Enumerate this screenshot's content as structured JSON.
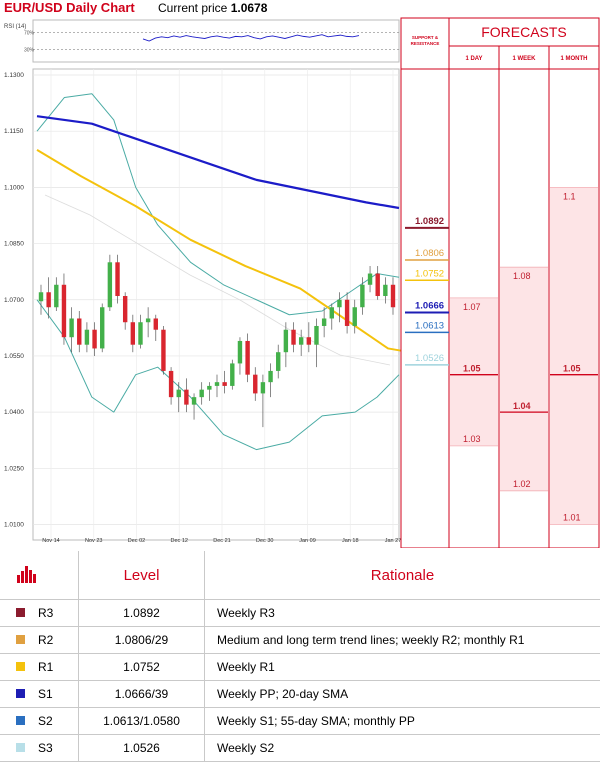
{
  "header": {
    "title": "EUR/USD Daily Chart",
    "price_label": "Current price",
    "price_value": "1.0678"
  },
  "rsi_label": "RSI (14)",
  "rsi_ticks": [
    "70%",
    "30%"
  ],
  "support_resistance_label": [
    "SUPPORT &",
    "RESISTANCE"
  ],
  "forecasts": {
    "title": "FORECASTS",
    "columns": [
      "1 DAY",
      "1 WEEK",
      "1 MONTH"
    ]
  },
  "colors": {
    "red": "#d0021b",
    "sma_long": "#1c1cc8",
    "sma_short": "#f4c20d",
    "bollinger": "#4aaba4",
    "up_candle": "#43b04a",
    "down_candle": "#d9262f",
    "pink_fill": "#fde4e6"
  },
  "chart_data": {
    "type": "candlestick",
    "title": "EUR/USD Daily Chart",
    "y_ticks": [
      "1.1300",
      "1.1150",
      "1.1000",
      "1.0850",
      "1.0700",
      "1.0550",
      "1.0400",
      "1.0250",
      "1.0100"
    ],
    "ylim": [
      1.008,
      1.13
    ],
    "x_ticks": [
      "Nov 14",
      "Nov 23",
      "Dec 02",
      "Dec 12",
      "Dec 21",
      "Dec 30",
      "Jan 09",
      "Jan 18",
      "Jan 27"
    ],
    "grid": true,
    "candles": [
      [
        1.0696,
        1.074,
        1.066,
        1.072
      ],
      [
        1.072,
        1.076,
        1.065,
        1.068
      ],
      [
        1.068,
        1.076,
        1.067,
        1.074
      ],
      [
        1.074,
        1.077,
        1.058,
        1.06
      ],
      [
        1.06,
        1.068,
        1.056,
        1.065
      ],
      [
        1.065,
        1.067,
        1.056,
        1.058
      ],
      [
        1.058,
        1.064,
        1.056,
        1.062
      ],
      [
        1.062,
        1.064,
        1.055,
        1.057
      ],
      [
        1.057,
        1.069,
        1.056,
        1.068
      ],
      [
        1.068,
        1.082,
        1.067,
        1.08
      ],
      [
        1.08,
        1.082,
        1.069,
        1.071
      ],
      [
        1.071,
        1.072,
        1.062,
        1.064
      ],
      [
        1.064,
        1.066,
        1.056,
        1.058
      ],
      [
        1.058,
        1.066,
        1.057,
        1.064
      ],
      [
        1.064,
        1.068,
        1.06,
        1.065
      ],
      [
        1.065,
        1.066,
        1.059,
        1.062
      ],
      [
        1.062,
        1.063,
        1.05,
        1.051
      ],
      [
        1.051,
        1.052,
        1.042,
        1.044
      ],
      [
        1.044,
        1.048,
        1.04,
        1.046
      ],
      [
        1.046,
        1.049,
        1.04,
        1.042
      ],
      [
        1.042,
        1.045,
        1.038,
        1.044
      ],
      [
        1.044,
        1.048,
        1.042,
        1.046
      ],
      [
        1.046,
        1.048,
        1.043,
        1.047
      ],
      [
        1.047,
        1.05,
        1.044,
        1.048
      ],
      [
        1.048,
        1.051,
        1.045,
        1.047
      ],
      [
        1.047,
        1.054,
        1.046,
        1.053
      ],
      [
        1.053,
        1.06,
        1.05,
        1.059
      ],
      [
        1.059,
        1.061,
        1.048,
        1.05
      ],
      [
        1.05,
        1.052,
        1.043,
        1.045
      ],
      [
        1.045,
        1.05,
        1.036,
        1.048
      ],
      [
        1.048,
        1.053,
        1.044,
        1.051
      ],
      [
        1.051,
        1.058,
        1.049,
        1.056
      ],
      [
        1.056,
        1.064,
        1.052,
        1.062
      ],
      [
        1.062,
        1.064,
        1.056,
        1.058
      ],
      [
        1.058,
        1.062,
        1.055,
        1.06
      ],
      [
        1.06,
        1.064,
        1.056,
        1.058
      ],
      [
        1.058,
        1.065,
        1.052,
        1.063
      ],
      [
        1.063,
        1.068,
        1.06,
        1.065
      ],
      [
        1.065,
        1.069,
        1.062,
        1.068
      ],
      [
        1.068,
        1.072,
        1.064,
        1.07
      ],
      [
        1.07,
        1.072,
        1.061,
        1.063
      ],
      [
        1.063,
        1.07,
        1.061,
        1.068
      ],
      [
        1.068,
        1.076,
        1.066,
        1.074
      ],
      [
        1.074,
        1.079,
        1.072,
        1.077
      ],
      [
        1.077,
        1.079,
        1.07,
        1.071
      ],
      [
        1.071,
        1.076,
        1.069,
        1.074
      ],
      [
        1.074,
        1.076,
        1.066,
        1.068
      ]
    ],
    "sma_long": [
      [
        0,
        1.119
      ],
      [
        10,
        1.117
      ],
      [
        20,
        1.112
      ],
      [
        30,
        1.107
      ],
      [
        40,
        1.102
      ],
      [
        50,
        1.099
      ],
      [
        60,
        1.096
      ],
      [
        66,
        1.0945
      ]
    ],
    "sma_short": [
      [
        0,
        1.11
      ],
      [
        8,
        1.103
      ],
      [
        18,
        1.095
      ],
      [
        28,
        1.086
      ],
      [
        38,
        1.079
      ],
      [
        48,
        1.073
      ],
      [
        55,
        1.066
      ],
      [
        60,
        1.061
      ],
      [
        64,
        1.057
      ],
      [
        68,
        1.056
      ]
    ],
    "bollinger_upper": [
      [
        0,
        1.115
      ],
      [
        5,
        1.124
      ],
      [
        10,
        1.125
      ],
      [
        14,
        1.118
      ],
      [
        18,
        1.1
      ],
      [
        22,
        1.09
      ],
      [
        28,
        1.08
      ],
      [
        34,
        1.074
      ],
      [
        40,
        1.07
      ],
      [
        46,
        1.066
      ],
      [
        52,
        1.067
      ],
      [
        58,
        1.073
      ],
      [
        62,
        1.077
      ],
      [
        66,
        1.076
      ]
    ],
    "bollinger_lower": [
      [
        0,
        1.07
      ],
      [
        5,
        1.06
      ],
      [
        10,
        1.044
      ],
      [
        14,
        1.04
      ],
      [
        18,
        1.05
      ],
      [
        22,
        1.052
      ],
      [
        28,
        1.044
      ],
      [
        34,
        1.034
      ],
      [
        40,
        1.03
      ],
      [
        46,
        1.032
      ],
      [
        52,
        1.039
      ],
      [
        58,
        1.04
      ],
      [
        62,
        1.044
      ],
      [
        66,
        1.05
      ]
    ],
    "rsi": [
      55,
      50,
      57,
      60,
      58,
      62,
      59,
      63,
      60,
      58,
      56,
      60,
      62,
      59,
      57,
      61,
      60,
      63,
      58,
      55,
      60,
      62,
      59,
      56,
      60,
      64,
      61,
      59,
      62,
      65,
      60,
      62,
      64,
      61,
      60,
      63
    ],
    "levels": [
      {
        "price": 1.0892,
        "label": "1.0892",
        "color": "#8b1b2e"
      },
      {
        "price": 1.0806,
        "label": "1.0806",
        "color": "#e0a040"
      },
      {
        "price": 1.0752,
        "label": "1.0752",
        "color": "#f4c20d"
      },
      {
        "price": 1.0666,
        "label": "1.0666",
        "color": "#1d1db4"
      },
      {
        "price": 1.0613,
        "label": "1.0613",
        "color": "#2a6fc0"
      },
      {
        "price": 1.0526,
        "label": "1.0526",
        "color": "#9fd3dd"
      }
    ],
    "forecast_bands": [
      {
        "col": 0,
        "top": 1.0705,
        "mid": 1.05,
        "bottom": 1.031,
        "top_label": "1.07",
        "mid_label": "1.05",
        "bottom_label": "1.03"
      },
      {
        "col": 1,
        "top": 1.0787,
        "mid": 1.04,
        "bottom": 1.019,
        "top_label": "1.08",
        "mid_label": "1.04",
        "bottom_label": "1.02"
      },
      {
        "col": 2,
        "top": 1.1,
        "mid": 1.05,
        "bottom": 1.01,
        "top_label": "1.1",
        "mid_label": "1.05",
        "bottom_label": "1.01"
      }
    ]
  },
  "table": {
    "headers": [
      "Level",
      "Rationale"
    ],
    "rows": [
      {
        "name": "R3",
        "level": "1.0892",
        "rationale": "Weekly R3",
        "color": "#8b1b2e"
      },
      {
        "name": "R2",
        "level": "1.0806/29",
        "rationale": "Medium and long term trend lines; weekly R2; monthly R1",
        "color": "#e0a040"
      },
      {
        "name": "R1",
        "level": "1.0752",
        "rationale": "Weekly R1",
        "color": "#f4c20d"
      },
      {
        "name": "S1",
        "level": "1.0666/39",
        "rationale": "Weekly PP; 20-day SMA",
        "color": "#1d1db4"
      },
      {
        "name": "S2",
        "level": "1.0613/1.0580",
        "rationale": "Weekly S1; 55-day SMA; monthly PP",
        "color": "#2a6fc0"
      },
      {
        "name": "S3",
        "level": "1.0526",
        "rationale": "Weekly S2",
        "color": "#b8dfe8"
      }
    ]
  }
}
